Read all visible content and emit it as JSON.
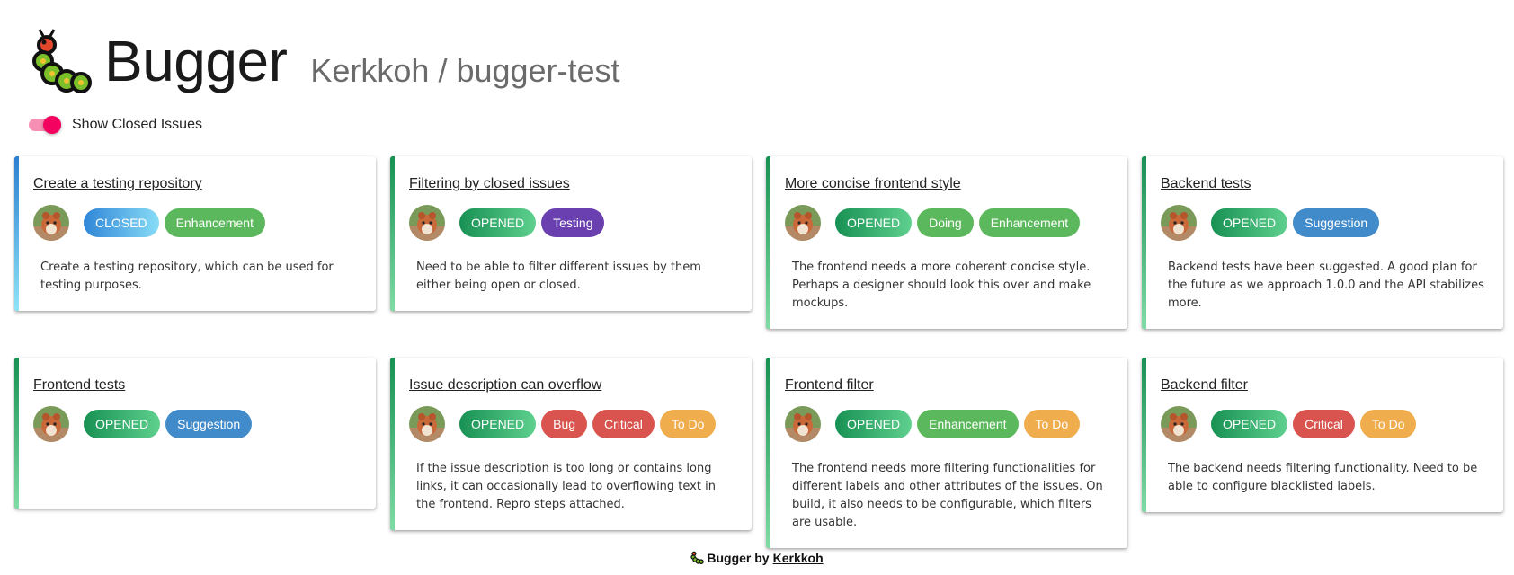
{
  "app": {
    "title": "Bugger",
    "repo": "Kerkkoh / bugger-test"
  },
  "toggle": {
    "label": "Show Closed Issues",
    "checked": true
  },
  "status_colors": {
    "OPENED": "linear-gradient(90deg,#179153,#5fd08e)",
    "CLOSED": "linear-gradient(90deg,#2f86d8,#88dcf6)"
  },
  "label_colors": {
    "Enhancement": "#5cb85c",
    "Testing": "#6a3fb0",
    "Doing": "#5cb85c",
    "Suggestion": "#428bca",
    "Bug": "#d9534f",
    "Critical": "#d9534f",
    "To Do": "#f0ad4e"
  },
  "issues": [
    {
      "title": "Create a testing repository",
      "status": "CLOSED",
      "labels": [
        "Enhancement"
      ],
      "description": "Create a testing repository, which can be used for testing purposes."
    },
    {
      "title": "Filtering by closed issues",
      "status": "OPENED",
      "labels": [
        "Testing"
      ],
      "description": "Need to be able to filter different issues by them either being open or closed."
    },
    {
      "title": "More concise frontend style",
      "status": "OPENED",
      "labels": [
        "Doing",
        "Enhancement"
      ],
      "description": "The frontend needs a more coherent concise style. Perhaps a designer should look this over and make mockups."
    },
    {
      "title": "Backend tests",
      "status": "OPENED",
      "labels": [
        "Suggestion"
      ],
      "description": "Backend tests have been suggested. A good plan for the future as we approach 1.0.0 and the API stabilizes more."
    },
    {
      "title": "Frontend tests",
      "status": "OPENED",
      "labels": [
        "Suggestion"
      ],
      "description": ""
    },
    {
      "title": "Issue description can overflow",
      "status": "OPENED",
      "labels": [
        "Bug",
        "Critical",
        "To Do"
      ],
      "description": "If the issue description is too long or contains long links, it can occasionally lead to overflowing text in the frontend. Repro steps attached."
    },
    {
      "title": "Frontend filter",
      "status": "OPENED",
      "labels": [
        "Enhancement",
        "To Do"
      ],
      "description": "The frontend needs more filtering functionalities for different labels and other attributes of the issues. On build, it also needs to be configurable, which filters are usable."
    },
    {
      "title": "Backend filter",
      "status": "OPENED",
      "labels": [
        "Critical",
        "To Do"
      ],
      "description": "The backend needs filtering functionality. Need to be able to configure blacklisted labels."
    }
  ],
  "footer": {
    "text": "Bugger by",
    "link": "Kerkkoh"
  }
}
